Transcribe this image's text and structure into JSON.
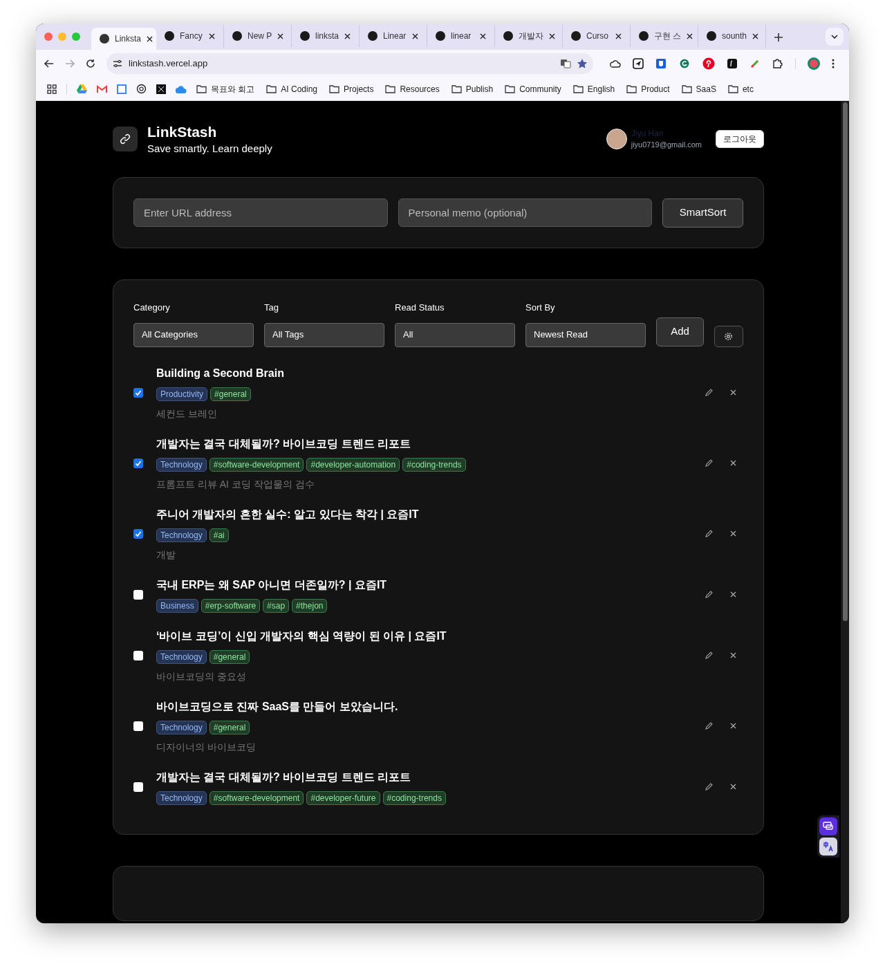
{
  "browser": {
    "tabs": [
      {
        "label": "Linksta",
        "selected": true
      },
      {
        "label": "Fancy",
        "selected": false
      },
      {
        "label": "New P",
        "selected": false
      },
      {
        "label": "linksta",
        "selected": false
      },
      {
        "label": "Linear",
        "selected": false
      },
      {
        "label": "linear",
        "selected": false
      },
      {
        "label": "개발자",
        "selected": false
      },
      {
        "label": "Curso",
        "selected": false
      },
      {
        "label": "구현 스",
        "selected": false
      },
      {
        "label": "sounth",
        "selected": false
      }
    ],
    "address": "linkstash.vercel.app",
    "bookmarks": [
      "목표와 회고",
      "AI Coding",
      "Projects",
      "Resources",
      "Publish",
      "Community",
      "English",
      "Product",
      "SaaS",
      "etc"
    ]
  },
  "header": {
    "title": "LinkStash",
    "subtitle": "Save smartly. Learn deeply",
    "user_name": "Jiyu Han",
    "user_email": "jiyu0719@gmail.com",
    "logout": "로그아웃"
  },
  "add_form": {
    "url_placeholder": "Enter URL address",
    "memo_placeholder": "Personal memo (optional)",
    "submit": "SmartSort"
  },
  "filters": [
    {
      "label": "Category",
      "value": "All Categories"
    },
    {
      "label": "Tag",
      "value": "All Tags"
    },
    {
      "label": "Read Status",
      "value": "All"
    },
    {
      "label": "Sort By",
      "value": "Newest Read"
    }
  ],
  "add_button": "Add",
  "links": [
    {
      "title": "Building a Second Brain",
      "checked": true,
      "category": "Productivity",
      "tags": [
        "#general"
      ],
      "memo": "세컨드 브레인"
    },
    {
      "title": "개발자는 결국 대체될까? 바이브코딩 트렌드 리포트",
      "checked": true,
      "category": "Technology",
      "tags": [
        "#software-development",
        "#developer-automation",
        "#coding-trends"
      ],
      "memo": "프롬프트 리뷰 AI 코딩 작업물의 검수"
    },
    {
      "title": "주니어 개발자의 흔한 실수: 알고 있다는 착각 | 요즘IT",
      "checked": true,
      "category": "Technology",
      "tags": [
        "#ai"
      ],
      "memo": "개발"
    },
    {
      "title": "국내 ERP는 왜 SAP 아니면 더존일까? | 요즘IT",
      "checked": false,
      "category": "Business",
      "tags": [
        "#erp-software",
        "#sap",
        "#thejon"
      ]
    },
    {
      "title": "‘바이브 코딩’이 신입 개발자의 핵심 역량이 된 이유 | 요즘IT",
      "checked": false,
      "category": "Technology",
      "tags": [
        "#general"
      ],
      "memo": "바이브코딩의 중요성"
    },
    {
      "title": "바이브코딩으로 진짜 SaaS를 만들어 보았습니다.",
      "checked": false,
      "category": "Technology",
      "tags": [
        "#general"
      ],
      "memo": "디자이너의 바이브코딩"
    },
    {
      "title": "개발자는 결국 대체될까? 바이브코딩 트렌드 리포트",
      "checked": false,
      "category": "Technology",
      "tags": [
        "#software-development",
        "#developer-future",
        "#coding-trends"
      ]
    }
  ]
}
